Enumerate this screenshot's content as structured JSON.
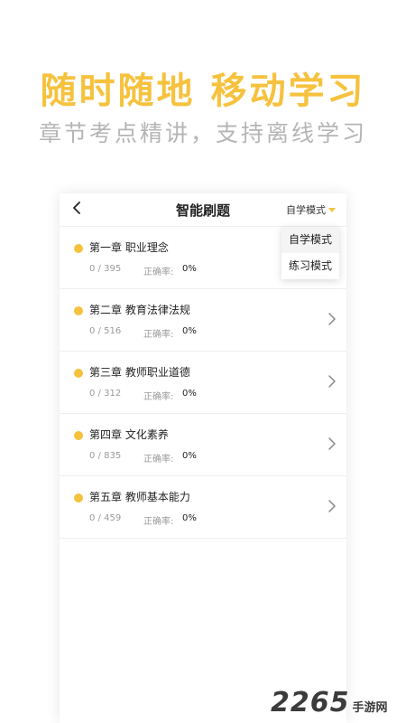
{
  "hero": {
    "title": "随时随地 移动学习",
    "subtitle": "章节考点精讲，支持离线学习"
  },
  "nav": {
    "back_icon": "chevron-left-icon",
    "title": "智能刷题",
    "mode_label": "自学模式"
  },
  "dropdown": {
    "options": [
      "自学模式",
      "练习模式"
    ],
    "selected": "自学模式"
  },
  "chapters": [
    {
      "title": "第一章 职业理念",
      "progress": "0 / 395",
      "accuracy_label": "正确率:",
      "accuracy": "0%"
    },
    {
      "title": "第二章 教育法律法规",
      "progress": "0 / 516",
      "accuracy_label": "正确率:",
      "accuracy": "0%"
    },
    {
      "title": "第三章 教师职业道德",
      "progress": "0 / 312",
      "accuracy_label": "正确率:",
      "accuracy": "0%"
    },
    {
      "title": "第四章 文化素养",
      "progress": "0 / 835",
      "accuracy_label": "正确率:",
      "accuracy": "0%"
    },
    {
      "title": "第五章 教师基本能力",
      "progress": "0 / 459",
      "accuracy_label": "正确率:",
      "accuracy": "0%"
    }
  ],
  "watermark": {
    "number": "2265",
    "text": "手游网"
  },
  "colors": {
    "accent": "#f6c23e",
    "subtitle": "#b5b5b5",
    "muted_text": "#9a9a9a"
  }
}
